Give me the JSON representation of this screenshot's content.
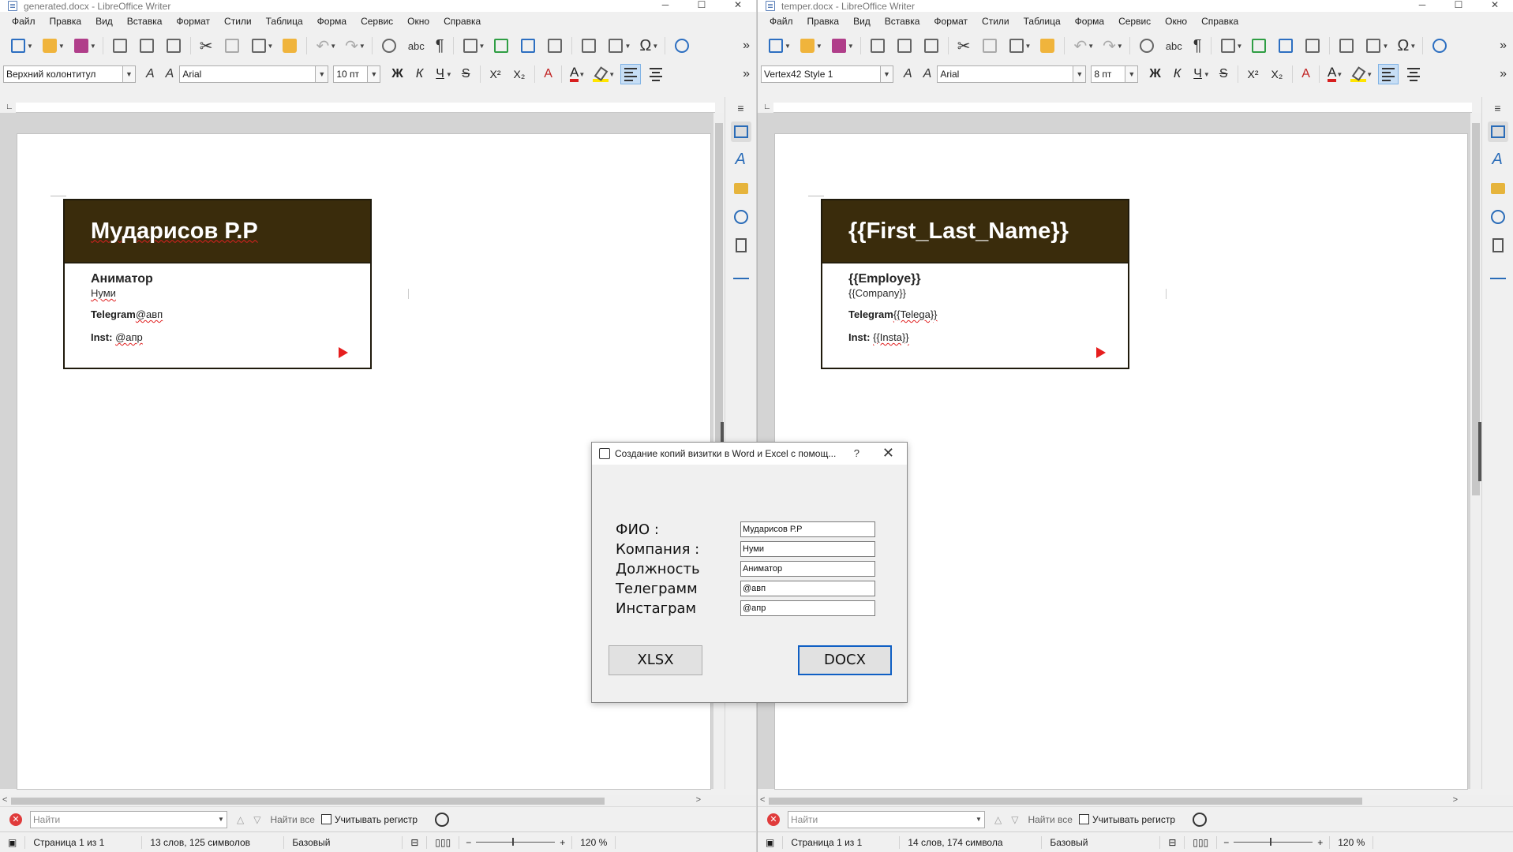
{
  "windows": [
    {
      "title": "generated.docx - LibreOffice Writer",
      "menu": [
        "Файл",
        "Правка",
        "Вид",
        "Вставка",
        "Формат",
        "Стили",
        "Таблица",
        "Форма",
        "Сервис",
        "Окно",
        "Справка"
      ],
      "paragraph_style": "Верхний колонтитул",
      "font_name": "Arial",
      "font_size": "10 пт",
      "card": {
        "name": "Мударисов Р.Р",
        "role": "Аниматор",
        "company": "Нуми",
        "telegram_label": "Telegram",
        "telegram_value": "@авп",
        "inst_label": "Inst:",
        "inst_value": "@апр"
      },
      "find_placeholder": "Найти",
      "find_all": "Найти все",
      "match_case": "Учитывать регистр",
      "status": {
        "page": "Страница 1 из 1",
        "words": "13 слов, 125 символов",
        "style": "Базовый",
        "zoom": "120 %"
      }
    },
    {
      "title": "temper.docx - LibreOffice Writer",
      "menu": [
        "Файл",
        "Правка",
        "Вид",
        "Вставка",
        "Формат",
        "Стили",
        "Таблица",
        "Форма",
        "Сервис",
        "Окно",
        "Справка"
      ],
      "paragraph_style": "Vertex42 Style 1",
      "font_name": "Arial",
      "font_size": "8 пт",
      "card": {
        "name": "{{First_Last_Name}}",
        "role": "{{Employe}}",
        "company": "{{Company}}",
        "telegram_label": "Telegram",
        "telegram_value": "{{Telega}}",
        "inst_label": "Inst:",
        "inst_value": "{{Insta}}"
      },
      "find_placeholder": "Найти",
      "find_all": "Найти все",
      "match_case": "Учитывать регистр",
      "status": {
        "page": "Страница 1 из 1",
        "words": "14 слов, 174 символа",
        "style": "Базовый",
        "zoom": "120 %"
      }
    }
  ],
  "formatting_buttons": {
    "bold": "Ж",
    "italic": "К",
    "underline": "Ч",
    "strike": "S",
    "superscript": "X²",
    "subscript": "X₂"
  },
  "dialog": {
    "title": "Создание копий визитки в Word и Excel с помощ...",
    "help": "?",
    "close": "✕",
    "fields": [
      {
        "label": "ФИО :",
        "value": "Мударисов Р.Р"
      },
      {
        "label": "Компания :",
        "value": "Нуми"
      },
      {
        "label": "Должность",
        "value": "Аниматор"
      },
      {
        "label": "Телеграмм",
        "value": "@авп"
      },
      {
        "label": "Инстаграм",
        "value": "@апр"
      }
    ],
    "buttons": {
      "xlsx": "XLSX",
      "docx": "DOCX"
    }
  },
  "colors": {
    "card_header": "#3a2c0c",
    "accent_arrow": "#e61e1e",
    "dialog_default_border": "#0f5fc4"
  }
}
